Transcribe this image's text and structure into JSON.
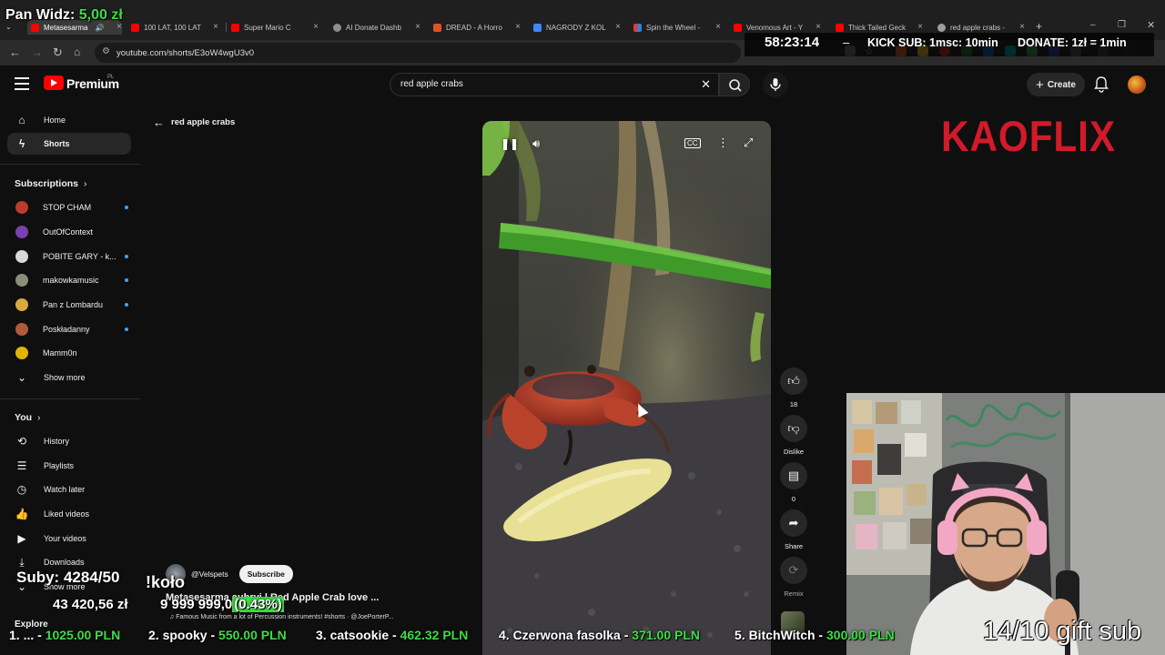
{
  "browser": {
    "tabs": [
      {
        "label": "Metasesarma",
        "active": true
      },
      {
        "label": "100 LAT, 100 LAT"
      },
      {
        "label": "Super Mario C"
      },
      {
        "label": "AI Donate Dashb"
      },
      {
        "label": "DREAD - A Horro"
      },
      {
        "label": "NAGRODY Z KOL"
      },
      {
        "label": "Spin the Wheel -"
      },
      {
        "label": "Venomous Art - Y"
      },
      {
        "label": "Thick Tailed Geck"
      },
      {
        "label": "red apple crabs -"
      }
    ],
    "url": "youtube.com/shorts/E3oW4wgU3v0"
  },
  "stream_overlay": {
    "top_left_label": "Pan Widz:",
    "top_left_amount": "5,00 zł",
    "timer": "58:23:14",
    "kick_sub": "KICK SUB: 1msc: 10min",
    "donate": "DONATE: 1zł = 1min",
    "subs": "Suby: 4284/50",
    "command": "!koło",
    "total": "43 420,56 zł",
    "goal_amount": "9 999 999,0",
    "goal_pct": "(0.43%)",
    "leaderboard": [
      {
        "name": "1. ...",
        "amount": "1025.00 PLN"
      },
      {
        "name": "2. spooky",
        "amount": "550.00 PLN"
      },
      {
        "name": "3. catsookie",
        "amount": "462.32 PLN"
      },
      {
        "name": "4. Czerwona fasolka",
        "amount": "371.00 PLN"
      },
      {
        "name": "5. BitchWitch",
        "amount": "300.00 PLN"
      }
    ],
    "gift_sub": "14/10 gift sub",
    "brand": "KAOFLIX"
  },
  "masthead": {
    "brand": "Premium",
    "region": "PL",
    "search_value": "red apple crabs",
    "create_label": "Create"
  },
  "sidebar": {
    "main": [
      {
        "label": "Home",
        "icon": "home-icon"
      },
      {
        "label": "Shorts",
        "icon": "shorts-icon",
        "active": true
      }
    ],
    "subscriptions_heading": "Subscriptions",
    "subscriptions": [
      {
        "label": "STOP CHAM",
        "color": "#c0392b"
      },
      {
        "label": "OutOfContext",
        "color": "#7a3fb1"
      },
      {
        "label": "POBITE GARY - k...",
        "color": "#d8d8d8"
      },
      {
        "label": "makowkamusic",
        "color": "#8a8f7a"
      },
      {
        "label": "Pan z Lombardu",
        "color": "#d8a93b"
      },
      {
        "label": "Poskładanny",
        "color": "#b05a3c"
      },
      {
        "label": "Mamm0n",
        "color": "#e0b400"
      }
    ],
    "show_more_1": "Show more",
    "you_heading": "You",
    "you_items": [
      {
        "label": "History",
        "icon": "history-icon"
      },
      {
        "label": "Playlists",
        "icon": "playlists-icon"
      },
      {
        "label": "Watch later",
        "icon": "watch-later-icon"
      },
      {
        "label": "Liked videos",
        "icon": "like-icon"
      },
      {
        "label": "Your videos",
        "icon": "your-videos-icon"
      },
      {
        "label": "Downloads",
        "icon": "download-icon"
      }
    ],
    "show_more_2": "Show more",
    "explore_heading": "Explore"
  },
  "shorts": {
    "back_label": "red apple crabs",
    "channel": "@Velspets",
    "subscribe": "Subscribe",
    "title": "Metasesarma aubryi | Red Apple Crab love ...",
    "music": "Famous Music from a lot of Percussion instruments! #shorts · @JoePorterP...",
    "actions": [
      {
        "name": "like",
        "label": "18"
      },
      {
        "name": "dislike",
        "label": "Dislike"
      },
      {
        "name": "comments",
        "label": "0"
      },
      {
        "name": "share",
        "label": "Share"
      },
      {
        "name": "remix",
        "label": "Remix"
      }
    ]
  }
}
